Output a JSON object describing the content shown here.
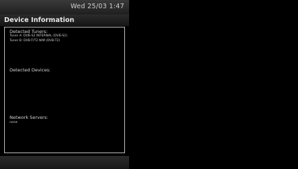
{
  "header": {
    "datetime": "Wed 25/03 1:47"
  },
  "title": "Device Information",
  "sections": {
    "tuners": {
      "heading": "Detected Tuners:",
      "lines": [
        "Tuner A: DVB-S2 INTERNAL (DVB-S2)",
        "Tuner B: DVB-T/T2 NIM (DVB-T2)"
      ]
    },
    "devices": {
      "heading": "Detected Devices:"
    },
    "network": {
      "heading": "Network Servers:",
      "value": "none"
    }
  },
  "colors": {
    "background": "#000000",
    "border": "#bdbdbd",
    "text": "#d6d6d6"
  }
}
